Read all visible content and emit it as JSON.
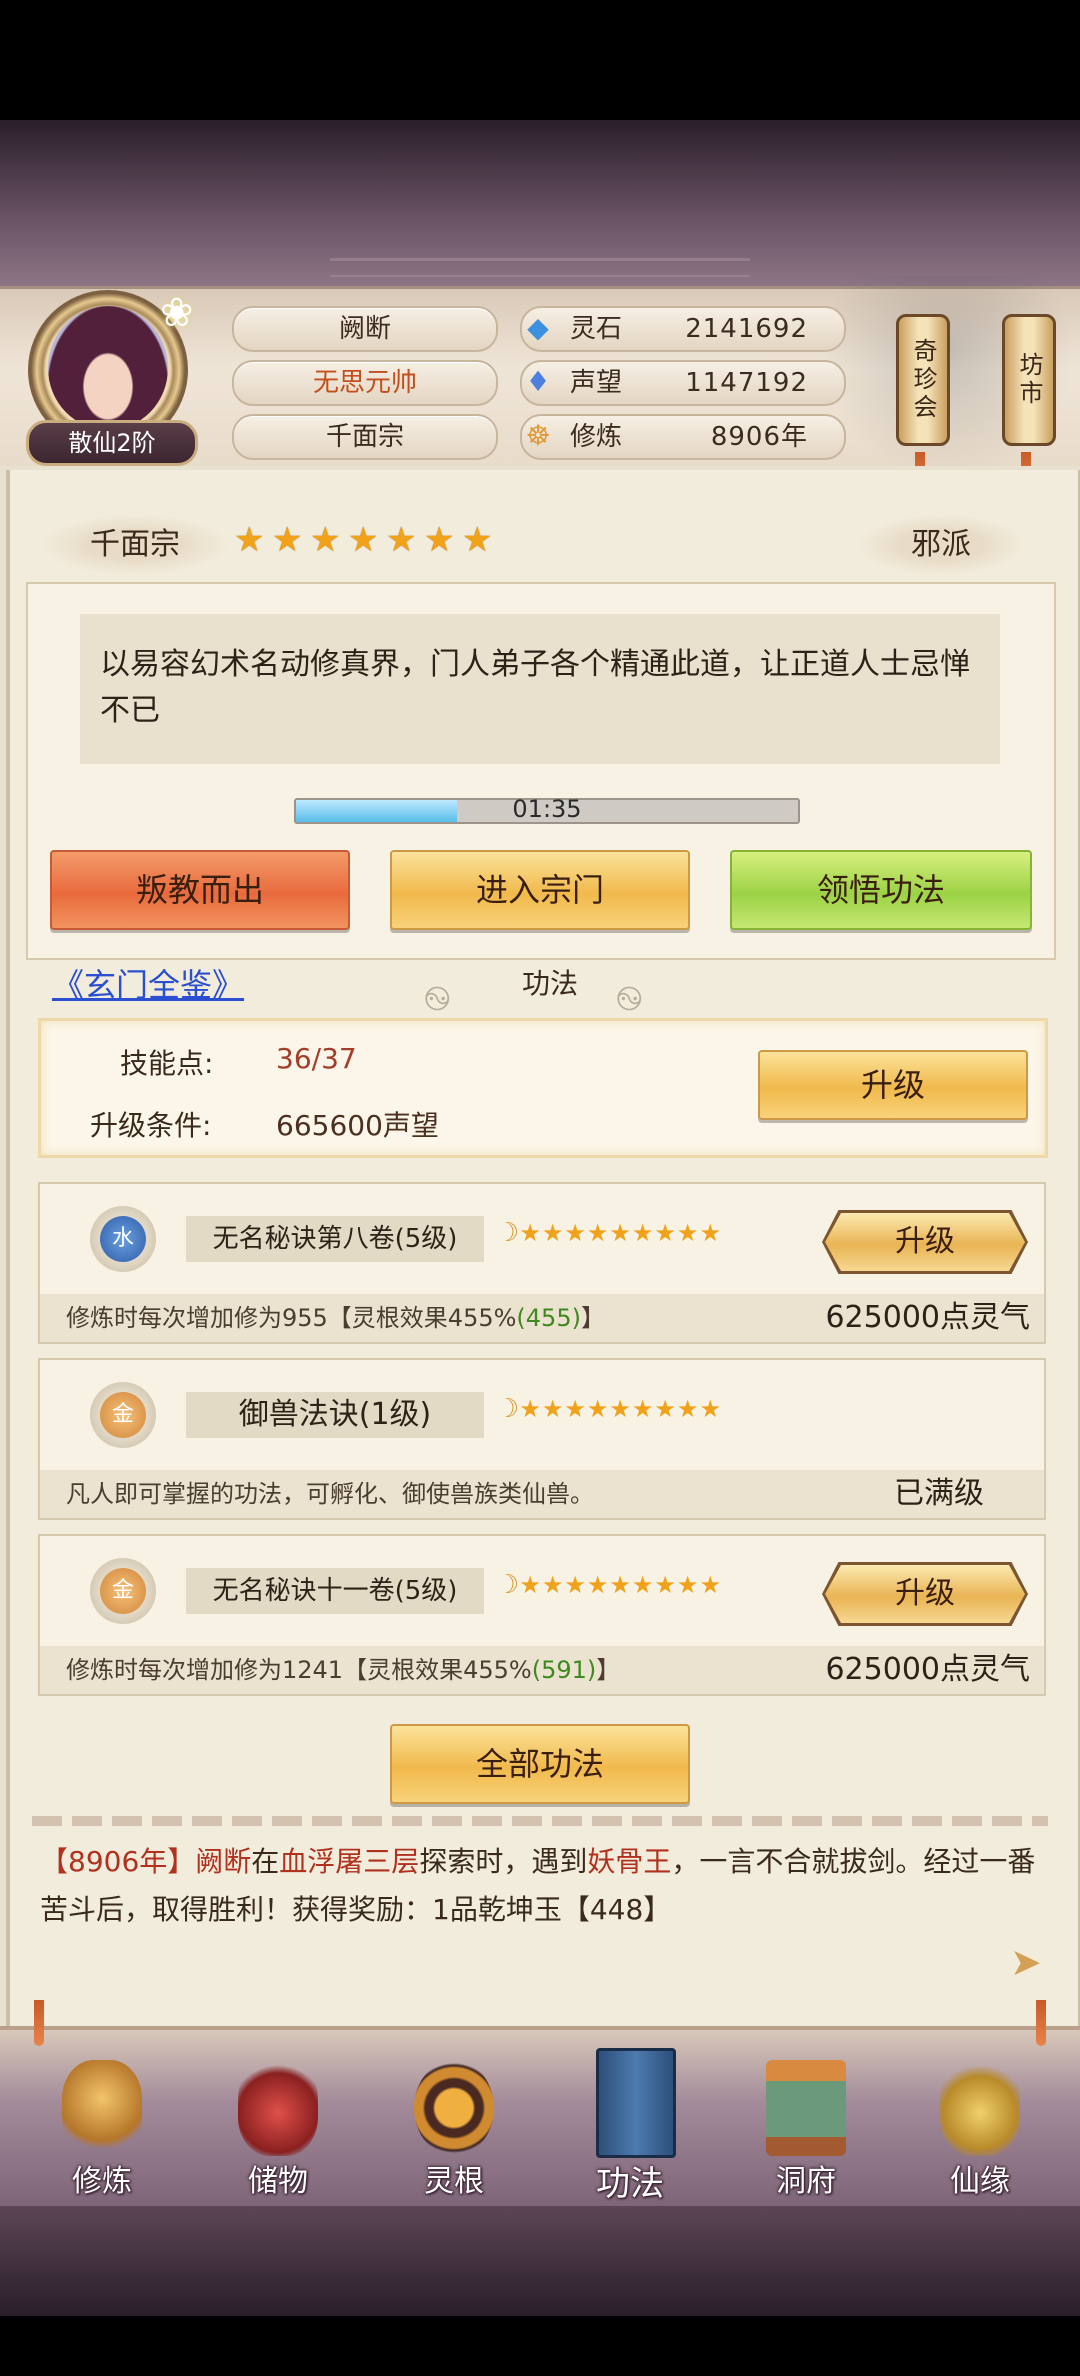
{
  "player": {
    "name": "阙断",
    "title": "无思元帅",
    "sect": "千面宗",
    "rank": "散仙2阶"
  },
  "resources": [
    {
      "label": "灵石",
      "value": "2141692",
      "icon": "spirit-stone-icon"
    },
    {
      "label": "声望",
      "value": "1147192",
      "icon": "reputation-icon"
    },
    {
      "label": "修炼",
      "value": "8906年",
      "icon": "cultivation-icon"
    }
  ],
  "side_buttons": {
    "qizhen": "奇珍会",
    "fangshi": "坊市"
  },
  "sect_info": {
    "name": "千面宗",
    "stars": 7,
    "alignment": "邪派",
    "description": "以易容幻术名动修真界，门人弟子各个精通此道，让正道人士忌惮不已",
    "timer": "01:35",
    "timer_progress": 0.32
  },
  "actions": {
    "leave": "叛教而出",
    "enter": "进入宗门",
    "comprehend": "领悟功法"
  },
  "link": "《玄门全鉴》",
  "tab_title": "功法",
  "skill_points": {
    "label_points": "技能点:",
    "points": "36/37",
    "label_cond": "升级条件:",
    "condition": "665600声望",
    "upgrade": "升级"
  },
  "techniques": [
    {
      "element": "水",
      "name": "无名秘诀第八卷(5级)",
      "stars": 9,
      "desc_prefix": "修炼时每次增加修为955【灵根效果455%",
      "desc_green": "(455)",
      "desc_suffix": "】",
      "cost": "625000点灵气",
      "button": "升级"
    },
    {
      "element": "金",
      "name": "御兽法诀(1级)",
      "stars": 9,
      "desc_prefix": "凡人即可掌握的功法，可孵化、御使兽族类仙兽。",
      "desc_green": "",
      "desc_suffix": "",
      "cost": "已满级",
      "button": ""
    },
    {
      "element": "金",
      "name": "无名秘诀十一卷(5级)",
      "stars": 9,
      "desc_prefix": "修炼时每次增加修为1241【灵根效果455%",
      "desc_green": "(591)",
      "desc_suffix": "】",
      "cost": "625000点灵气",
      "button": "升级"
    }
  ],
  "all_techniques": "全部功法",
  "event": {
    "p1": "【8906年】",
    "p2": "阙断",
    "p3": "在",
    "p4": "血浮屠三层",
    "p5": "探索时，遇到",
    "p6": "妖骨王",
    "p7": "，一言不合就拔剑。经过一番苦斗后，取得胜利！获得奖励：1品乾坤玉【448】"
  },
  "nav": [
    "修炼",
    "储物",
    "灵根",
    "功法",
    "洞府",
    "仙缘"
  ],
  "colors": {
    "accent_red": "#b0321e",
    "link_blue": "#2a4fd0",
    "star_gold": "#f0a21a",
    "green": "#3e8a1e"
  }
}
